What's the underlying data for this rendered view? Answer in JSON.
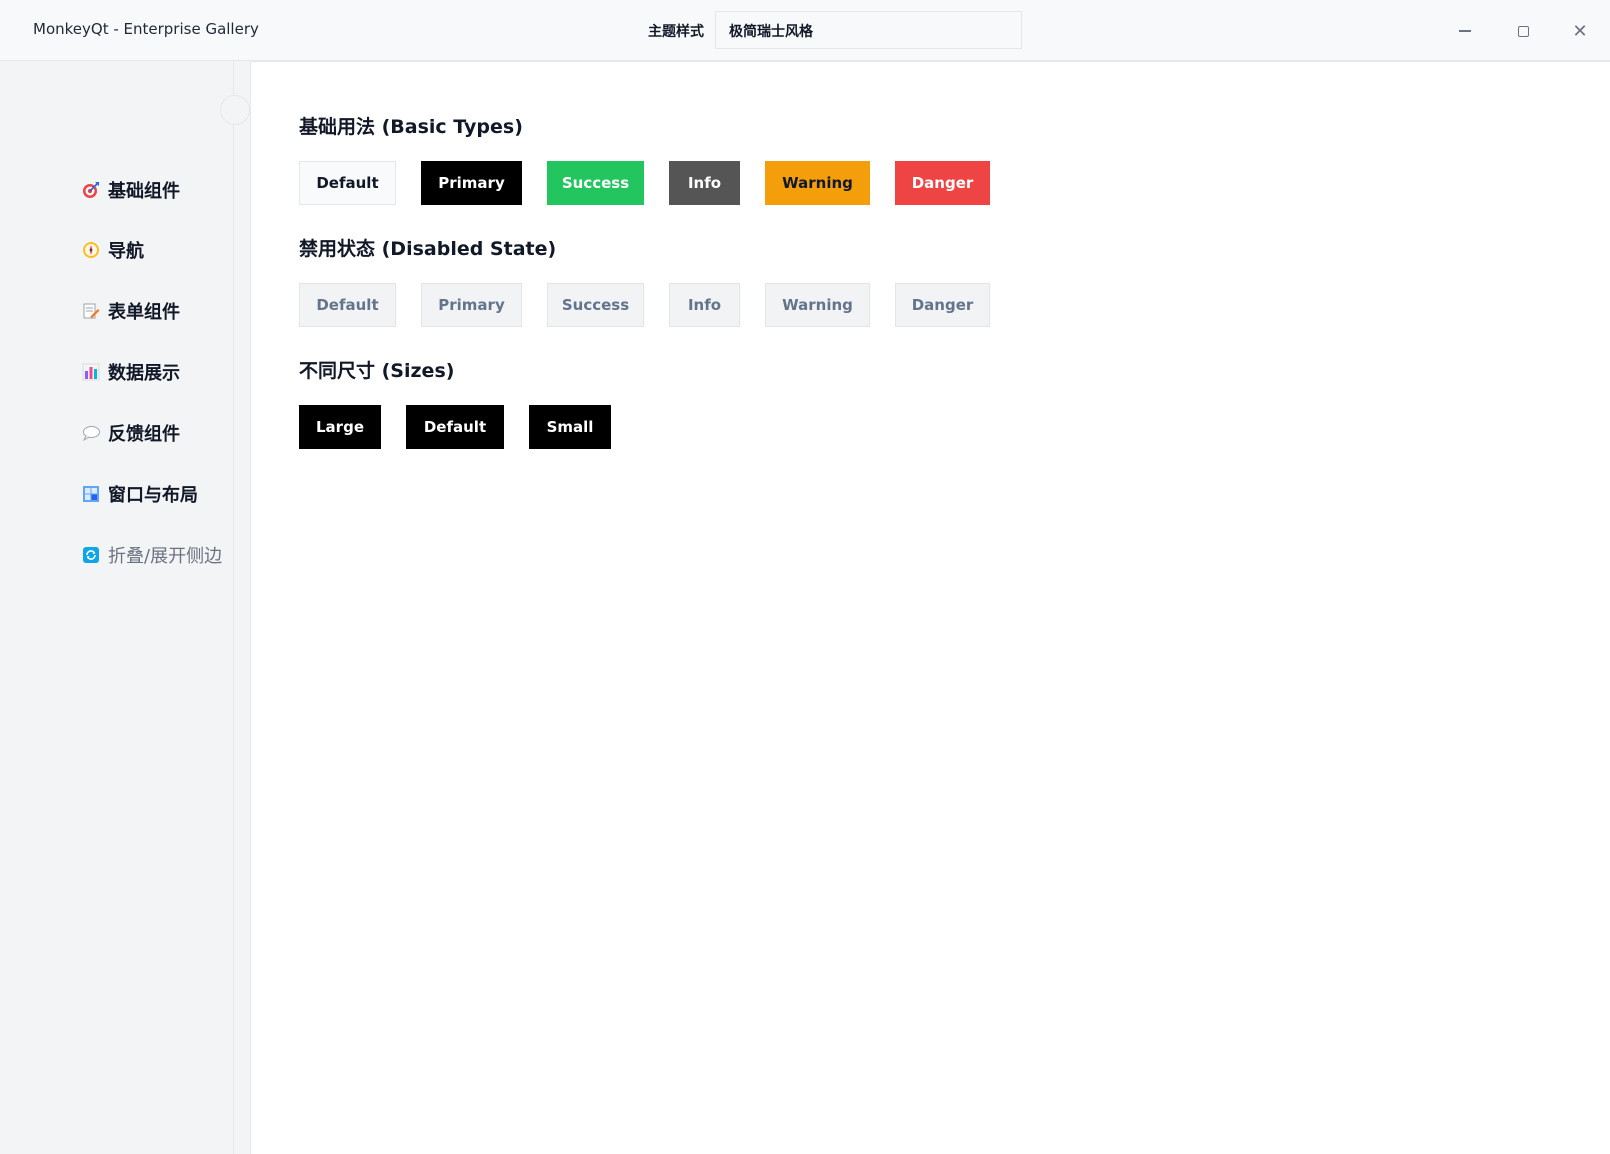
{
  "titlebar": {
    "app_title": "MonkeyQt - Enterprise Gallery",
    "theme_label": "主题样式",
    "theme_value": "极简瑞士风格",
    "minimize_icon": "minimize-icon",
    "maximize_icon": "maximize-icon",
    "close_icon": "close-icon",
    "close_glyph": "✕"
  },
  "sidebar": {
    "items": [
      {
        "label": "基础组件",
        "icon": "target-icon"
      },
      {
        "label": "导航",
        "icon": "compass-icon"
      },
      {
        "label": "表单组件",
        "icon": "memo-icon"
      },
      {
        "label": "数据展示",
        "icon": "bar-chart-icon"
      },
      {
        "label": "反馈组件",
        "icon": "speech-bubble-icon"
      },
      {
        "label": "窗口与布局",
        "icon": "window-icon"
      },
      {
        "label": "折叠/展开侧边栏",
        "icon": "refresh-icon"
      }
    ]
  },
  "content": {
    "basic": {
      "title": "基础用法 (Basic Types)",
      "buttons": [
        "Default",
        "Primary",
        "Success",
        "Info",
        "Warning",
        "Danger"
      ]
    },
    "disabled": {
      "title": "禁用状态 (Disabled State)",
      "buttons": [
        "Default",
        "Primary",
        "Success",
        "Info",
        "Warning",
        "Danger"
      ]
    },
    "sizes": {
      "title": "不同尺寸 (Sizes)",
      "buttons": [
        "Large",
        "Default",
        "Small"
      ]
    }
  },
  "colors": {
    "primary": "#000000",
    "success": "#22c55e",
    "info": "#555555",
    "warning": "#f59e0b",
    "danger": "#ef4444"
  }
}
